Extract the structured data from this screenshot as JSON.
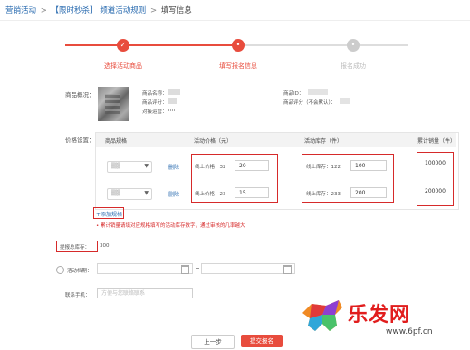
{
  "breadcrumb": {
    "items": [
      "营销活动",
      "【限时秒杀】 频道活动规则",
      "填写信息"
    ],
    "separator": ">"
  },
  "steps": [
    {
      "label": "选择活动商品",
      "state": "done",
      "icon": "check-icon"
    },
    {
      "label": "填写报名信息",
      "state": "active",
      "icon": "dot-icon"
    },
    {
      "label": "报名成功",
      "state": "todo",
      "icon": "dot-icon"
    }
  ],
  "product": {
    "label": "商品概况：",
    "name_label": "商品名称：",
    "rating_label": "商品评分：",
    "discount_label": "对接运营：",
    "discount_value": "nn",
    "id_label": "商品ID：",
    "score_label": "商品评分（不会默认）："
  },
  "specs": {
    "label": "价格设置：",
    "headers": [
      "商品规格",
      "活动价格（元）",
      "活动库存（件）",
      "累计销量（件）"
    ],
    "rows": [
      {
        "online_price": "线上价格：32",
        "price_value": "20",
        "online_stock": "线上库存：122",
        "stock_value": "100",
        "sales": "100000",
        "delete": "删除"
      },
      {
        "online_price": "线上价格：23",
        "price_value": "15",
        "online_stock": "线上库存：233",
        "stock_value": "200",
        "sales": "200000",
        "delete": "删除"
      }
    ],
    "add_link": "+添加规格",
    "warning": "• 累计销量请填对应规格填写的活动库存数字，通过审核的几率越大"
  },
  "total_stock": {
    "label": "提报总库存：",
    "value": "300"
  },
  "activity_time": {
    "label": "活动档期："
  },
  "phone": {
    "label": "联系手机：",
    "placeholder": "方便与您联络联系"
  },
  "buttons": {
    "prev": "上一步",
    "submit": "提交报名"
  },
  "watermark": {
    "brand": "乐发网",
    "url": "www.6pf.cn"
  },
  "colors": {
    "accent": "#e84c3d",
    "muted": "#cccccc",
    "link": "#2b6cb0",
    "highlight": "#d62a2a"
  }
}
